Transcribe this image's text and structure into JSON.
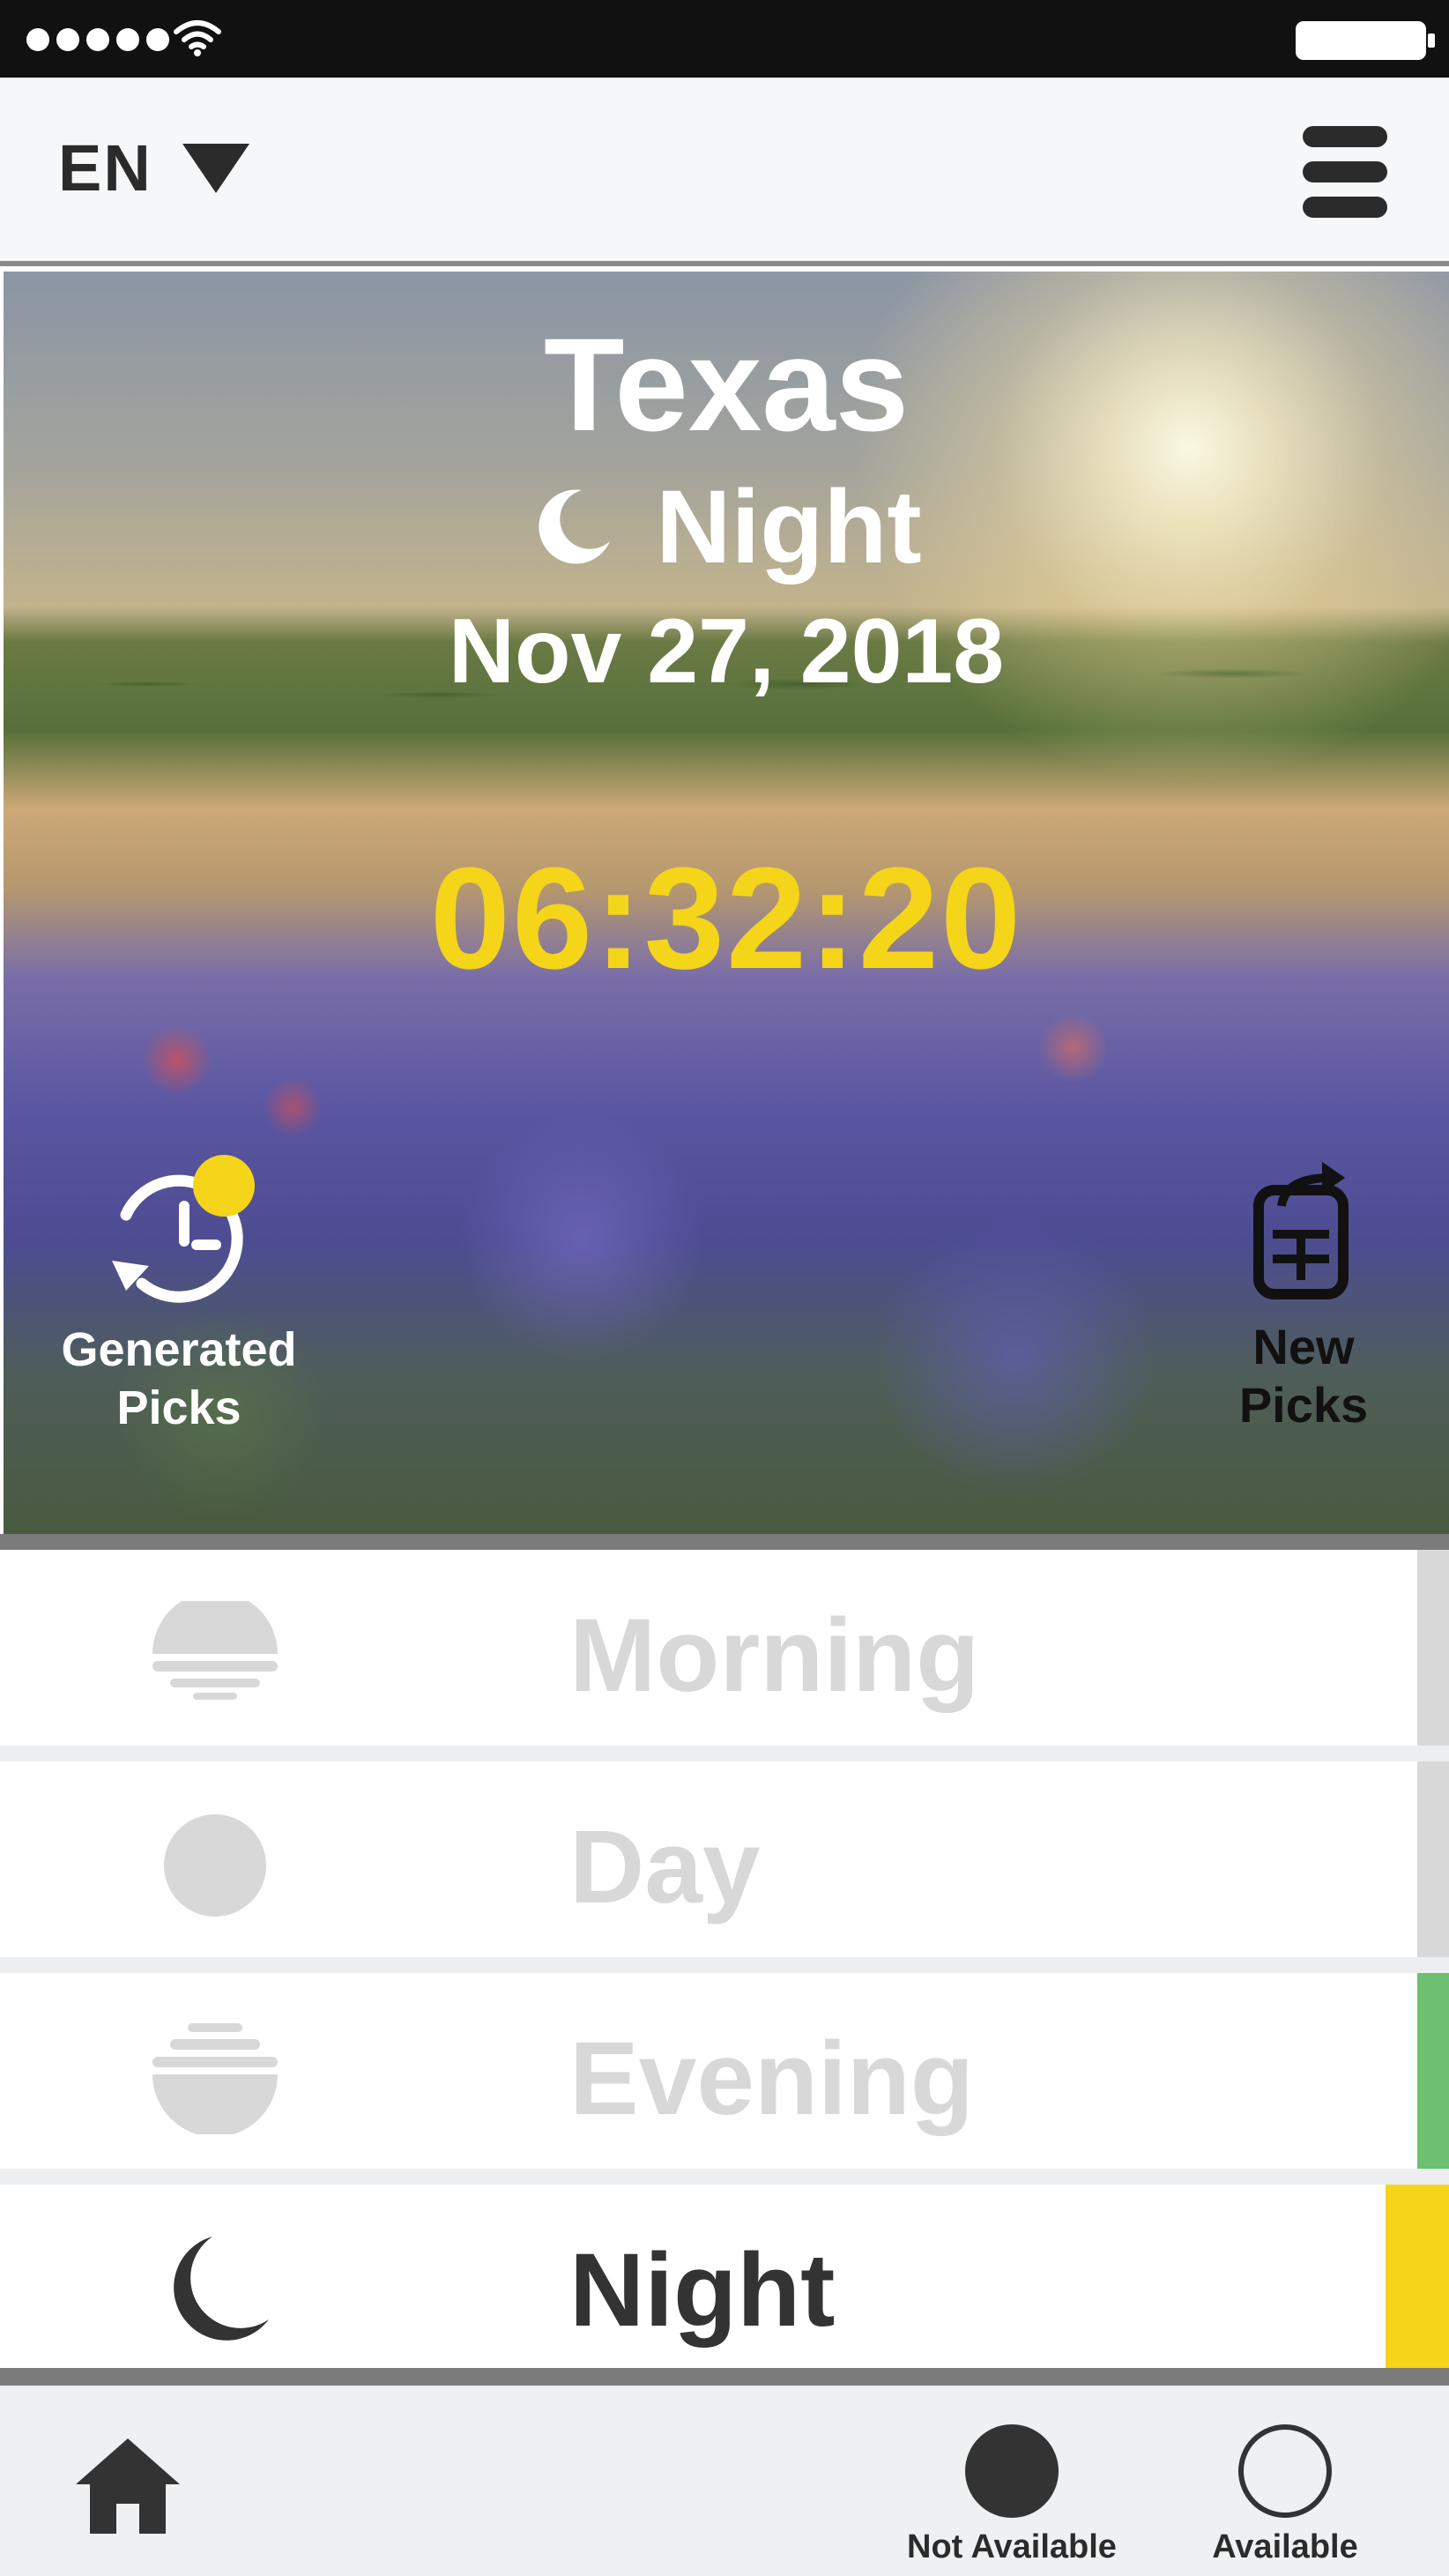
{
  "status_bar": {
    "signal_icon": "signal-dots-icon",
    "wifi_icon": "wifi-icon",
    "battery_icon": "battery-full-icon"
  },
  "header": {
    "language": "EN",
    "language_icon": "triangle-down-icon",
    "menu_icon": "hamburger-menu-icon"
  },
  "hero": {
    "location": "Texas",
    "period_icon": "moon-icon",
    "period": "Night",
    "date": "Nov 27, 2018",
    "countdown": "06:32:20",
    "countdown_color": "#f5d519",
    "generated_picks": {
      "line1": "Generated",
      "line2": "Picks",
      "icon": "history-clock-icon",
      "badge_color": "#f5d519"
    },
    "new_picks": {
      "line1": "New",
      "line2": "Picks",
      "icon": "new-picks-icon"
    }
  },
  "periods": [
    {
      "label": "Morning",
      "icon": "sunrise-icon",
      "text_color": "#d8d8d8",
      "indicator_color": "#d8d8d8",
      "active": false
    },
    {
      "label": "Day",
      "icon": "sun-icon",
      "text_color": "#d8d8d8",
      "indicator_color": "#d8d8d8",
      "active": false
    },
    {
      "label": "Evening",
      "icon": "sunset-icon",
      "text_color": "#d8d8d8",
      "indicator_color": "#6cc070",
      "active": false
    },
    {
      "label": "Night",
      "icon": "moon-icon",
      "text_color": "#333333",
      "indicator_color": "#f5d519",
      "active": true
    }
  ],
  "bottom_bar": {
    "home_icon": "home-icon",
    "legend": [
      {
        "label": "Not Available",
        "style": "filled"
      },
      {
        "label": "Available",
        "style": "outline"
      }
    ]
  }
}
